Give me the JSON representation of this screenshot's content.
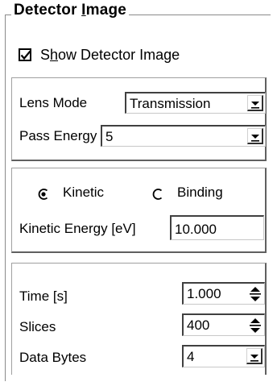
{
  "group": {
    "title_prefix": "Detector ",
    "title_mnemonic": "I",
    "title_suffix": "mage"
  },
  "show_image": {
    "checked": true,
    "label_prefix": "S",
    "label_mnemonic": "h",
    "label_suffix": "ow Detector Image"
  },
  "lens": {
    "lens_mode_label": "Lens Mode",
    "lens_mode_value": "Transmission",
    "pass_energy_label": "Pass Energy",
    "pass_energy_value": "5"
  },
  "energy": {
    "kinetic_label": "Kinetic",
    "binding_label": "Binding",
    "selected": "Kinetic",
    "kinetic_energy_label": "Kinetic Energy [eV]",
    "kinetic_energy_value": "10.000"
  },
  "acquisition": {
    "time_label": "Time [s]",
    "time_value": "1.000",
    "slices_label": "Slices",
    "slices_value": "400",
    "data_bytes_label": "Data Bytes",
    "data_bytes_value": "4"
  },
  "icons": {
    "checkbox_check": "check-icon",
    "combo_arrow": "chevron-down-icon",
    "spin": "spin-arrows-icon"
  }
}
